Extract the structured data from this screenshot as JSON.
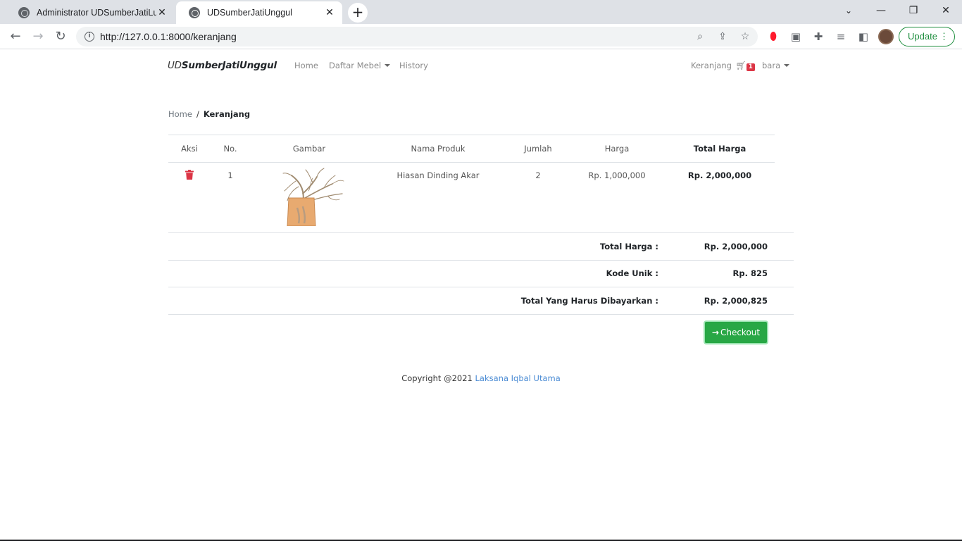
{
  "browser": {
    "tabs": [
      {
        "title": "Administrator UDSumberJatiLuhur",
        "close": "✕"
      },
      {
        "title": "UDSumberJatiUnggul",
        "close": "✕"
      }
    ],
    "new_tab": "+",
    "window_controls": {
      "minimize": "—",
      "restore": "❐",
      "close": "✕"
    },
    "url": "http://127.0.0.1:8000/keranjang",
    "update_label": "Update",
    "icons": [
      "back-icon",
      "forward-icon",
      "reload-icon",
      "info-icon",
      "zoom-icon",
      "share-icon",
      "star-icon",
      "opera-icon",
      "extension-icon",
      "puzzle-icon",
      "media-icon",
      "sidepanel-icon",
      "profile-avatar",
      "menu-icon"
    ]
  },
  "navbar": {
    "brand_light": "UD",
    "brand_bold": "SumberJatiUnggul",
    "links": {
      "home": "Home",
      "daftar_mebel": "Daftar Mebel",
      "history": "History"
    },
    "cart_label": "Keranjang",
    "cart_count": "1",
    "user": "bara"
  },
  "breadcrumb": {
    "home": "Home",
    "separator": "/",
    "current": "Keranjang"
  },
  "cart_table": {
    "headers": [
      "Aksi",
      "No.",
      "Gambar",
      "Nama Produk",
      "Jumlah",
      "Harga",
      "Total Harga"
    ],
    "rows": [
      {
        "no": "1",
        "image": "hiasan-dinding-akar-image",
        "name": "Hiasan Dinding Akar",
        "qty": "2",
        "price": "Rp. 1,000,000",
        "total": "Rp. 2,000,000"
      }
    ]
  },
  "summary": {
    "total_label": "Total Harga :",
    "total_value": "Rp. 2,000,000",
    "kode_label": "Kode Unik :",
    "kode_value": "Rp. 825",
    "grand_label": "Total Yang Harus Dibayarkan :",
    "grand_value": "Rp. 2,000,825"
  },
  "checkout_label": "Checkout",
  "footer": {
    "text": "Copyright @2021",
    "link": "Laksana Iqbal Utama"
  },
  "colors": {
    "accent_green": "#28a745",
    "danger": "#dc3545",
    "link_blue": "#4a8bd4"
  }
}
